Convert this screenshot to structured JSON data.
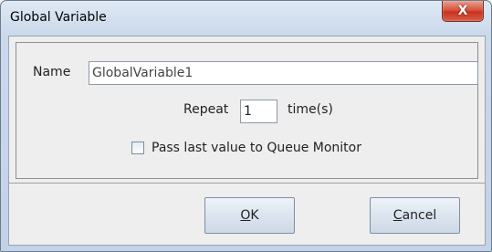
{
  "window": {
    "title": "Global Variable",
    "close_glyph": "X"
  },
  "form": {
    "name_label": "Name",
    "name_value": "GlobalVariable1",
    "repeat_label": "Repeat",
    "repeat_value": "1",
    "times_label": "time(s)",
    "checkbox_label": "Pass last value to Queue Monitor",
    "checkbox_checked": false
  },
  "buttons": {
    "ok_mnemonic": "O",
    "ok_rest": "K",
    "cancel_mnemonic": "C",
    "cancel_rest": "ancel"
  },
  "icons": {
    "close": "close-icon",
    "checkbox": "checkbox-icon"
  }
}
